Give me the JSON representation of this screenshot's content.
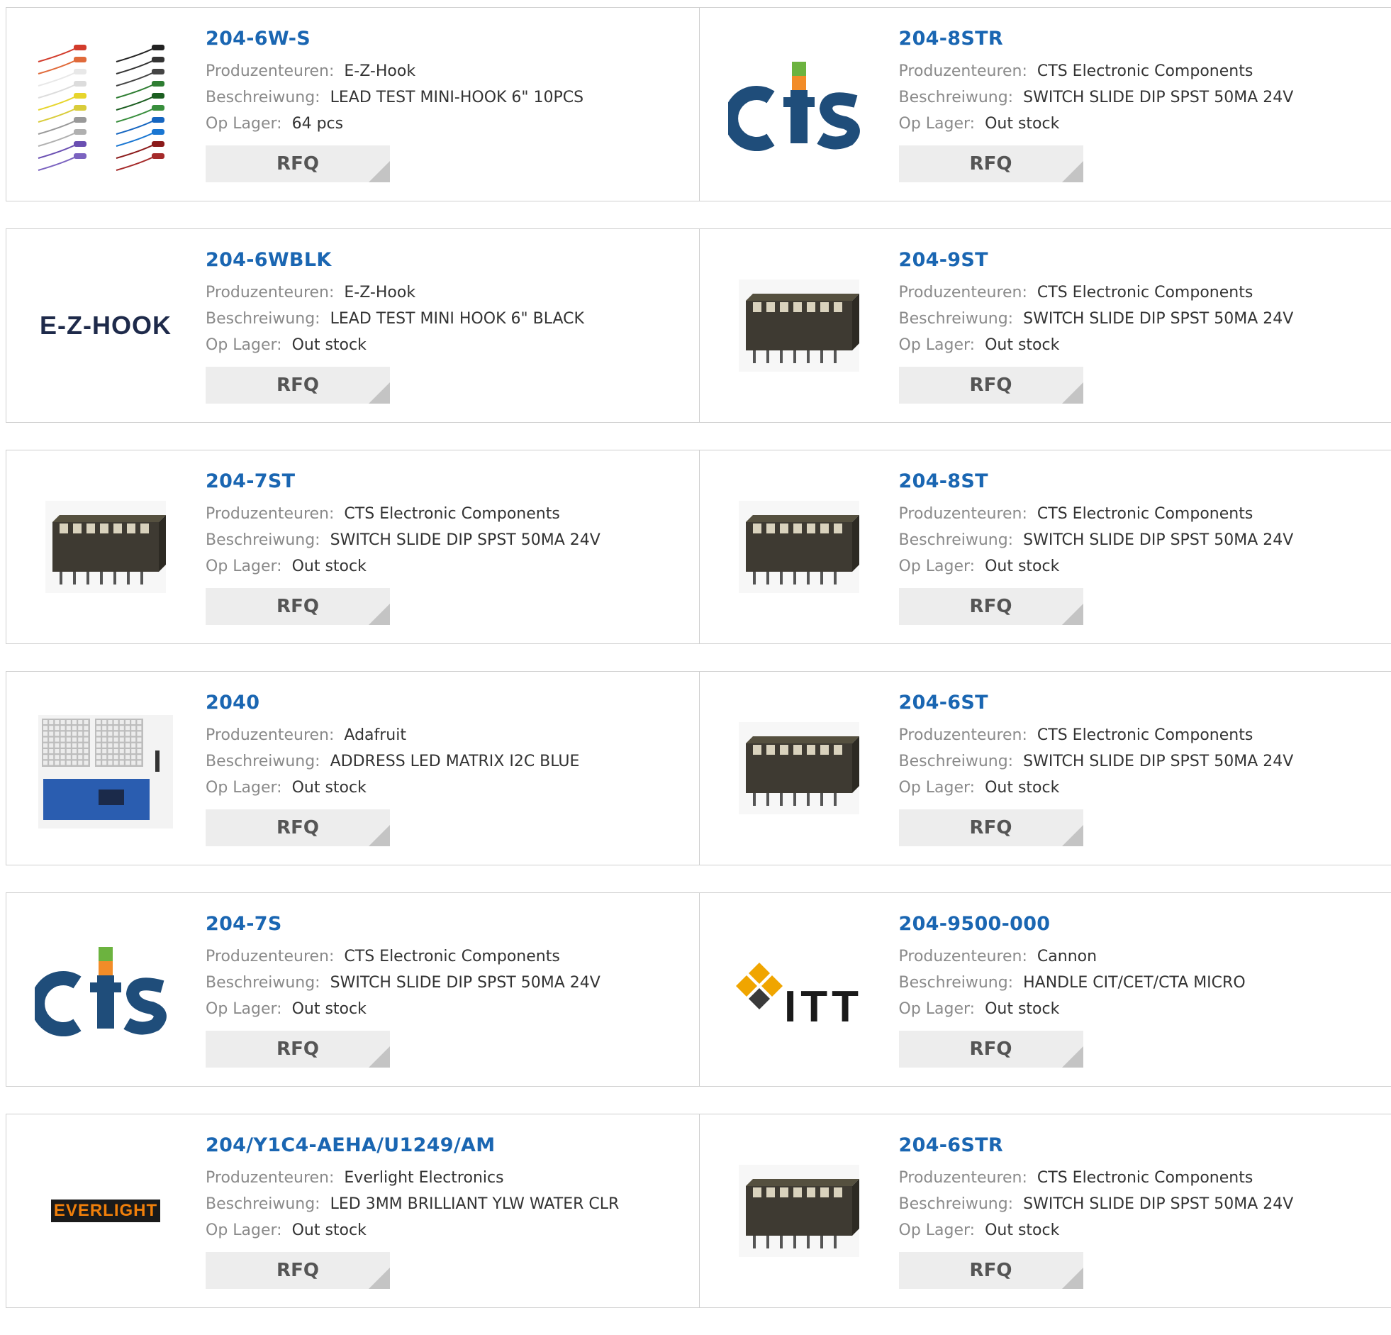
{
  "labels": {
    "manufacturer": "Produzenteuren:",
    "description": "Beschreiwung:",
    "stock": "Op Lager:",
    "rfq": "RFQ"
  },
  "rows": [
    [
      {
        "part": "204-6W-S",
        "manufacturer": "E-Z-Hook",
        "description": "LEAD TEST MINI-HOOK 6\" 10PCS",
        "stock": "64 pcs",
        "image": "test-hooks-image"
      },
      {
        "part": "204-8STR",
        "manufacturer": "CTS Electronic Components",
        "description": "SWITCH SLIDE DIP SPST 50MA 24V",
        "stock": "Out stock",
        "image": "cts-logo"
      }
    ],
    [
      {
        "part": "204-6WBLK",
        "manufacturer": "E-Z-Hook",
        "description": "LEAD TEST MINI HOOK 6\" BLACK",
        "stock": "Out stock",
        "image": "ezhook-logo",
        "logo_text": "E-Z-HOOK"
      },
      {
        "part": "204-9ST",
        "manufacturer": "CTS Electronic Components",
        "description": "SWITCH SLIDE DIP SPST 50MA 24V",
        "stock": "Out stock",
        "image": "dip-switch-image"
      }
    ],
    [
      {
        "part": "204-7ST",
        "manufacturer": "CTS Electronic Components",
        "description": "SWITCH SLIDE DIP SPST 50MA 24V",
        "stock": "Out stock",
        "image": "dip-switch-image"
      },
      {
        "part": "204-8ST",
        "manufacturer": "CTS Electronic Components",
        "description": "SWITCH SLIDE DIP SPST 50MA 24V",
        "stock": "Out stock",
        "image": "dip-switch-image"
      }
    ],
    [
      {
        "part": "2040",
        "manufacturer": "Adafruit",
        "description": "ADDRESS LED MATRIX I2C BLUE",
        "stock": "Out stock",
        "image": "led-matrix-image"
      },
      {
        "part": "204-6ST",
        "manufacturer": "CTS Electronic Components",
        "description": "SWITCH SLIDE DIP SPST 50MA 24V",
        "stock": "Out stock",
        "image": "dip-switch-image"
      }
    ],
    [
      {
        "part": "204-7S",
        "manufacturer": "CTS Electronic Components",
        "description": "SWITCH SLIDE DIP SPST 50MA 24V",
        "stock": "Out stock",
        "image": "cts-logo"
      },
      {
        "part": "204-9500-000",
        "manufacturer": "Cannon",
        "description": "HANDLE CIT/CET/CTA MICRO",
        "stock": "Out stock",
        "image": "itt-logo",
        "logo_text": "ITT"
      }
    ],
    [
      {
        "part": "204/Y1C4-AEHA/U1249/AM",
        "manufacturer": "Everlight Electronics",
        "description": "LED 3MM BRILLIANT YLW WATER CLR",
        "stock": "Out stock",
        "image": "everlight-logo",
        "logo_text": "EVERLIGHT"
      },
      {
        "part": "204-6STR",
        "manufacturer": "CTS Electronic Components",
        "description": "SWITCH SLIDE DIP SPST 50MA 24V",
        "stock": "Out stock",
        "image": "dip-switch-image"
      }
    ]
  ],
  "colors": {
    "link": "#1a66b2",
    "cts_blue": "#1f4d7a",
    "cts_orange": "#f28c28",
    "cts_green": "#6cb33f",
    "itt_gold": "#f0a500",
    "everlight_orange": "#f07f0a",
    "pcb_blue": "#2a5db0"
  }
}
